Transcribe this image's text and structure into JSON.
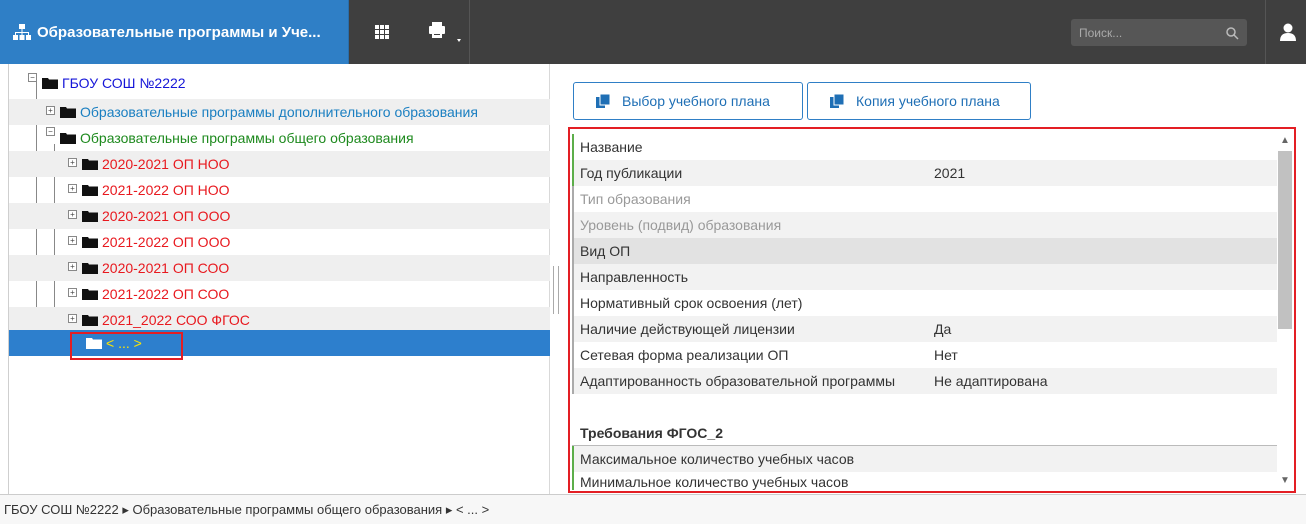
{
  "header": {
    "app_title": "Образовательные программы и Уче...",
    "search_placeholder": "Поиск...",
    "icons": {
      "app": "sitemap-icon",
      "grid": "grid-icon",
      "print": "printer-icon",
      "search": "search-icon",
      "user": "user-icon"
    }
  },
  "tree": {
    "root": "ГБОУ СОШ №2222",
    "groups": [
      {
        "label": "Образовательные программы дополнительного образования",
        "color": "#1a7fc1"
      },
      {
        "label": "Образовательные программы общего образования",
        "color": "#1e8a1e"
      }
    ],
    "items": [
      {
        "label": "2020-2021 ОП НОО"
      },
      {
        "label": "2021-2022 ОП НОО"
      },
      {
        "label": "2020-2021 ОП ООО"
      },
      {
        "label": "2021-2022 ОП ООО"
      },
      {
        "label": "2020-2021 ОП СОО"
      },
      {
        "label": "2021-2022 ОП СОО"
      },
      {
        "label": "2021_2022 СОО ФГОС"
      }
    ],
    "selected_label": "< ... >",
    "colors": {
      "root": "#1515d8",
      "item": "#e8181e",
      "selected_text": "#ffe600",
      "selected_bg": "#2d7fcd"
    }
  },
  "toolbar": {
    "select_plan": "Выбор учебного плана",
    "copy_plan": "Копия учебного плана"
  },
  "properties": [
    {
      "key": "Название",
      "value": ""
    },
    {
      "key": "Год публикации",
      "value": "2021"
    },
    {
      "key": "Тип образования",
      "value": ""
    },
    {
      "key": "Уровень (подвид) образования",
      "value": ""
    },
    {
      "key": "Вид ОП",
      "value": ""
    },
    {
      "key": "Направленность",
      "value": ""
    },
    {
      "key": "Нормативный срок освоения (лет)",
      "value": ""
    },
    {
      "key": "Наличие действующей лицензии",
      "value": "Да"
    },
    {
      "key": "Сетевая форма реализации ОП",
      "value": "Нет"
    },
    {
      "key": "Адаптированность образовательной программы",
      "value": "Не адаптирована"
    }
  ],
  "section": {
    "title": "Требования ФГОС_2",
    "rows": [
      {
        "key": "Максимальное количество учебных часов"
      },
      {
        "key": "Минимальное количество учебных часов"
      }
    ]
  },
  "statusbar": {
    "path": "ГБОУ СОШ №2222 ▸ Образовательные программы общего образования ▸ < ... >"
  }
}
